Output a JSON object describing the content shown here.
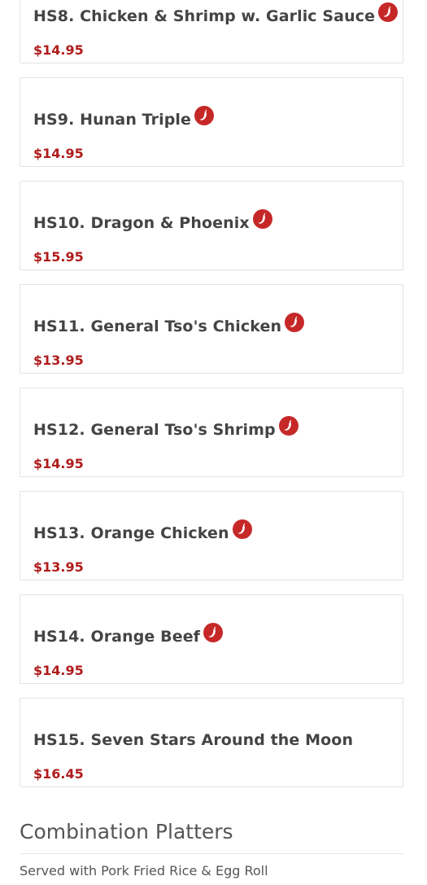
{
  "menu": {
    "items": [
      {
        "name": "HS8. Chicken & Shrimp w. Garlic Sauce",
        "price": "$14.95",
        "spicy": true
      },
      {
        "name": "HS9. Hunan Triple",
        "price": "$14.95",
        "spicy": true
      },
      {
        "name": "HS10. Dragon & Phoenix",
        "price": "$15.95",
        "spicy": true
      },
      {
        "name": "HS11. General Tso's Chicken",
        "price": "$13.95",
        "spicy": true
      },
      {
        "name": "HS12. General Tso's Shrimp",
        "price": "$14.95",
        "spicy": true
      },
      {
        "name": "HS13. Orange Chicken",
        "price": "$13.95",
        "spicy": true
      },
      {
        "name": "HS14. Orange Beef",
        "price": "$14.95",
        "spicy": true
      },
      {
        "name": "HS15. Seven Stars Around the Moon",
        "price": "$16.45",
        "spicy": false
      }
    ]
  },
  "section": {
    "title": "Combination Platters",
    "description": "Served with Pork Fried Rice & Egg Roll"
  },
  "colors": {
    "price": "#b01c1c",
    "spicy_icon": "#c62828",
    "text": "#444444"
  },
  "icons": {
    "spicy": "chili-pepper-icon"
  }
}
